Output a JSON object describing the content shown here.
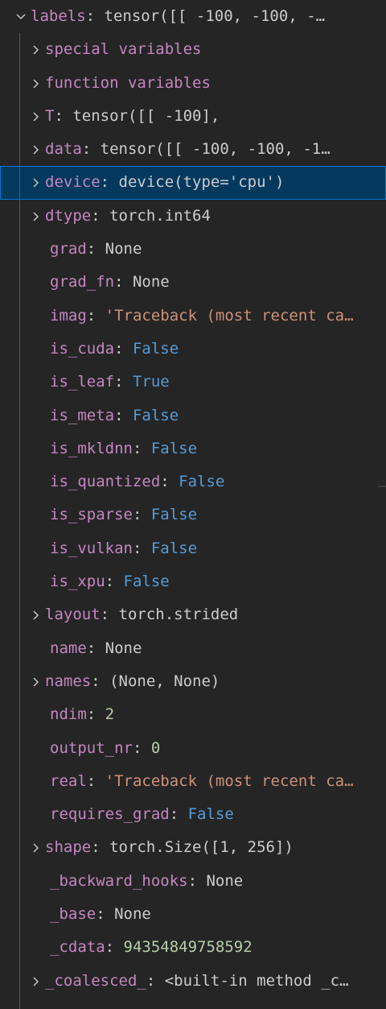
{
  "root": {
    "key": "labels",
    "value": "tensor([[ -100,  -100,  -…"
  },
  "items": [
    {
      "expandable": true,
      "key": "special variables",
      "value": "",
      "type": "plain"
    },
    {
      "expandable": true,
      "key": "function variables",
      "value": "",
      "type": "plain"
    },
    {
      "expandable": true,
      "key": "T",
      "value": "tensor([[ -100],",
      "type": "plain"
    },
    {
      "expandable": true,
      "key": "data",
      "value": "tensor([[ -100,  -100,  -1…",
      "type": "plain"
    },
    {
      "expandable": true,
      "key": "device",
      "value": "device(type='cpu')",
      "type": "plain",
      "selected": true
    },
    {
      "expandable": true,
      "key": "dtype",
      "value": "torch.int64",
      "type": "plain"
    },
    {
      "expandable": false,
      "key": "grad",
      "value": "None",
      "type": "plain"
    },
    {
      "expandable": false,
      "key": "grad_fn",
      "value": "None",
      "type": "plain"
    },
    {
      "expandable": false,
      "key": "imag",
      "value": "'Traceback (most recent ca…",
      "type": "str"
    },
    {
      "expandable": false,
      "key": "is_cuda",
      "value": "False",
      "type": "kw"
    },
    {
      "expandable": false,
      "key": "is_leaf",
      "value": "True",
      "type": "kw"
    },
    {
      "expandable": false,
      "key": "is_meta",
      "value": "False",
      "type": "kw"
    },
    {
      "expandable": false,
      "key": "is_mkldnn",
      "value": "False",
      "type": "kw"
    },
    {
      "expandable": false,
      "key": "is_quantized",
      "value": "False",
      "type": "kw"
    },
    {
      "expandable": false,
      "key": "is_sparse",
      "value": "False",
      "type": "kw"
    },
    {
      "expandable": false,
      "key": "is_vulkan",
      "value": "False",
      "type": "kw"
    },
    {
      "expandable": false,
      "key": "is_xpu",
      "value": "False",
      "type": "kw"
    },
    {
      "expandable": true,
      "key": "layout",
      "value": "torch.strided",
      "type": "plain"
    },
    {
      "expandable": false,
      "key": "name",
      "value": "None",
      "type": "plain"
    },
    {
      "expandable": true,
      "key": "names",
      "value": "(None, None)",
      "type": "plain"
    },
    {
      "expandable": false,
      "key": "ndim",
      "value": "2",
      "type": "num"
    },
    {
      "expandable": false,
      "key": "output_nr",
      "value": "0",
      "type": "num"
    },
    {
      "expandable": false,
      "key": "real",
      "value": "'Traceback (most recent ca…",
      "type": "str"
    },
    {
      "expandable": false,
      "key": "requires_grad",
      "value": "False",
      "type": "kw"
    },
    {
      "expandable": true,
      "key": "shape",
      "value": "torch.Size([1, 256])",
      "type": "plain"
    },
    {
      "expandable": false,
      "key": "_backward_hooks",
      "value": "None",
      "type": "plain"
    },
    {
      "expandable": false,
      "key": "_base",
      "value": "None",
      "type": "plain"
    },
    {
      "expandable": false,
      "key": "_cdata",
      "value": "94354849758592",
      "type": "num"
    },
    {
      "expandable": true,
      "key": "_coalesced_",
      "value": "<built-in method _c…",
      "type": "plain"
    }
  ]
}
